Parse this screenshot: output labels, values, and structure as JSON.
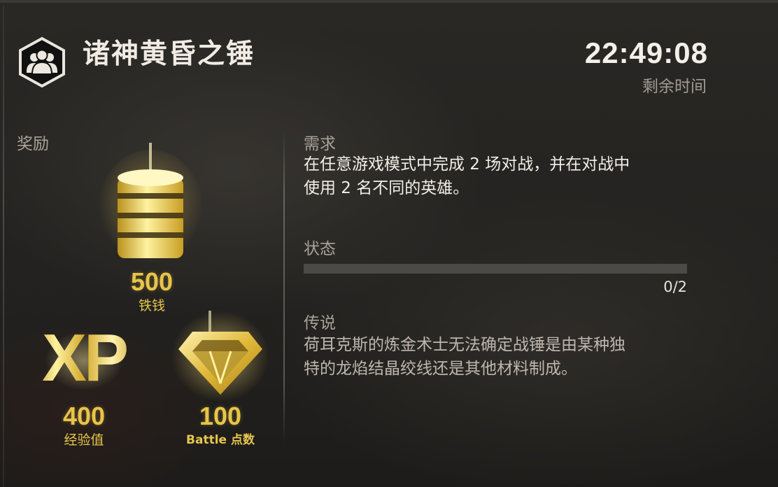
{
  "header": {
    "title": "诸神黄昏之锤",
    "timer_value": "22:49:08",
    "timer_label": "剩余时间"
  },
  "rewards": {
    "label": "奖励",
    "coins": {
      "amount": "500",
      "label": "铁钱",
      "icon": "coin-stack-icon"
    },
    "xp": {
      "amount": "400",
      "label": "经验值",
      "icon": "xp-icon",
      "icon_text": "XP"
    },
    "battle_points": {
      "amount": "100",
      "label": "Battle 点数",
      "icon": "diamond-icon"
    }
  },
  "requirement": {
    "label": "需求",
    "line1": "在任意游戏模式中完成 2 场对战，并在对战中",
    "line2": "使用 2 名不同的英雄。"
  },
  "status": {
    "label": "状态",
    "progress_text": "0/2",
    "progress_fraction": 0
  },
  "lore": {
    "label": "传说",
    "line1": "荷耳克斯的炼金术士无法确定战锤是由某种独",
    "line2": "特的龙焰结晶绞线还是其他材料制成。"
  },
  "colors": {
    "gold": "#e8c448",
    "progress_track": "#4c4a46"
  }
}
